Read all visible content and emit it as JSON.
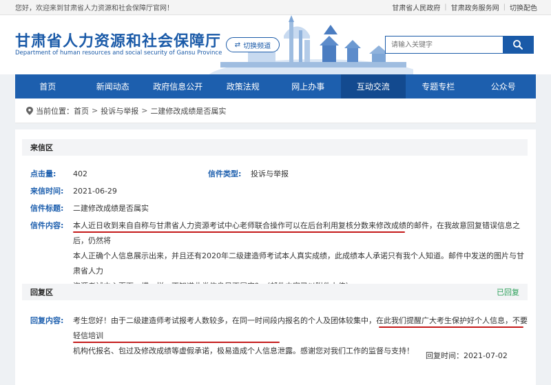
{
  "topbar": {
    "welcome": "您好，欢迎来到甘肃省人力资源和社会保障厅官网！",
    "links": [
      "甘肃省人民政府",
      "甘肃政务服务网",
      "切换配色"
    ]
  },
  "header": {
    "title_cn": "甘肃省人力资源和社会保障厅",
    "title_en": "Department of human resources and social security of Gansu Province",
    "switch_label": "切换频道",
    "search_placeholder": "请输入关键字"
  },
  "nav": [
    "首页",
    "新闻动态",
    "政府信息公开",
    "政策法规",
    "网上办事",
    "互动交流",
    "专题专栏",
    "公众号"
  ],
  "nav_active": "互动交流",
  "breadcrumb": {
    "prefix": "当前位置：",
    "items": [
      "首页",
      "投诉与举报",
      "二建修改成绩是否属实"
    ],
    "sep": ">"
  },
  "letter": {
    "section_title": "来信区",
    "clicks_label": "点击量:",
    "clicks_value": "402",
    "type_label": "信件类型:",
    "type_value": "投诉与举报",
    "time_label": "来信时间:",
    "time_value": "2021-06-29",
    "subject_label": "信件标题:",
    "subject_value": "二建修改成绩是否属实",
    "content_label": "信件内容:",
    "content_lines": [
      "本人近日收到来自自称与甘肃省人力资源考试中心老师联合操作可以在后台利用复核分数来修改成绩的邮件，在我故意回复错误信息之后，仍然将",
      "本人正确个人信息展示出来，并且还有2020年二级建造师考试本人真实成绩，此成绩本人承诺只有我个人知道。邮件中发送的图片与甘肃省人力",
      "资源考试中心页面一模一样，不知道此类信息是否属实？（邮件内容已以附件上传）"
    ]
  },
  "reply": {
    "section_title": "回复区",
    "status": "已回复",
    "content_label": "回复内容:",
    "content_lines": [
      "考生您好！由于二级建造师考试报考人数较多，在同一时间段内报名的个人及团体较集中，在此我们提醒广大考生保护好个人信息，不要轻信培训",
      "机构代报名、包过及修改成绩等虚假承诺，极易造成个人信息泄露。感谢您对我们工作的监督与支持！"
    ],
    "reply_time_label": "回复时间：",
    "reply_time_value": "2021-07-02"
  },
  "colors": {
    "brand": "#1d5fae",
    "underline": "#c41a1a",
    "replied": "#2aa058"
  }
}
